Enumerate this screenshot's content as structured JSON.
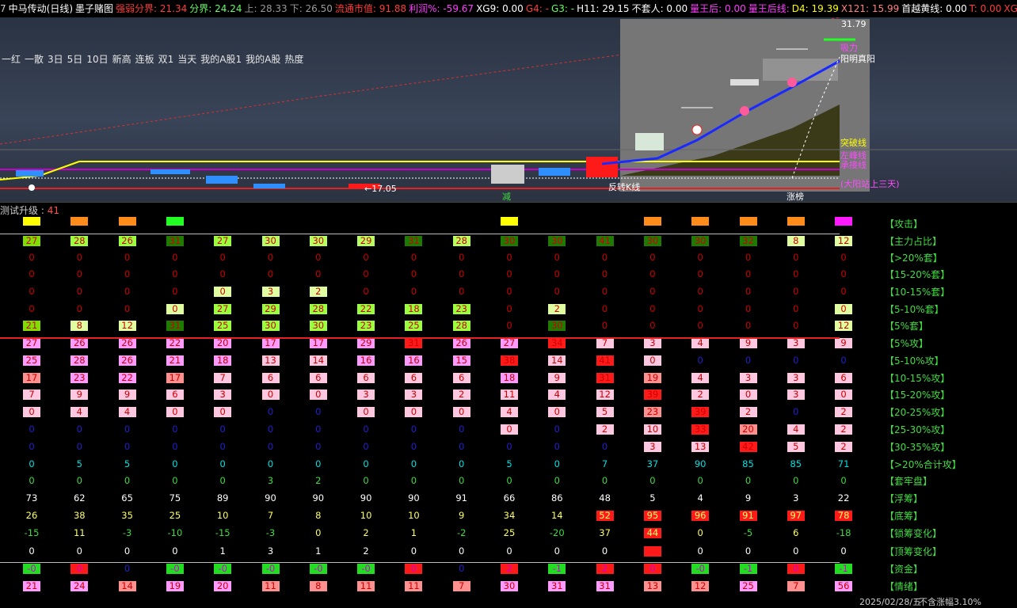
{
  "title_bar": {
    "items": [
      {
        "text": "7",
        "color": "#cccccc"
      },
      {
        "text": "中马传动(日线)",
        "color": "#ffffff"
      },
      {
        "text": "墨子赌图",
        "color": "#ffffff"
      },
      {
        "text": "强弱分界: 21.34",
        "color": "#ff3b3b"
      },
      {
        "text": "分界: 24.24",
        "color": "#5fff5f"
      },
      {
        "text": "上: 28.33",
        "color": "#9a9a9a"
      },
      {
        "text": "下: 26.50",
        "color": "#9a9a9a"
      },
      {
        "text": "流通市值: 91.88",
        "color": "#ff3b3b"
      },
      {
        "text": "利润%: -59.67",
        "color": "#ff3bff"
      },
      {
        "text": "XG9: 0.00",
        "color": "#ffffff"
      },
      {
        "text": "G4: -",
        "color": "#ff3b3b"
      },
      {
        "text": "G3: -",
        "color": "#5fff5f"
      },
      {
        "text": "H11: 29.15",
        "color": "#ffffff"
      },
      {
        "text": "不套人: 0.00",
        "color": "#ffffff"
      },
      {
        "text": "量王后: 0.00",
        "color": "#ff3bff"
      },
      {
        "text": "量王后线:",
        "color": "#ff3bff"
      },
      {
        "text": "D4: 19.39",
        "color": "#ffff00"
      },
      {
        "text": "X121: 15.99",
        "color": "#ff8080"
      },
      {
        "text": "首越黄线: 0.00",
        "color": "#ffffff"
      },
      {
        "text": "T: 0.00",
        "color": "#ff3b3b"
      },
      {
        "text": "XG",
        "color": "#ff3b3b"
      }
    ]
  },
  "quicklinks": [
    "一红",
    "一散",
    "3日",
    "5日",
    "10日",
    "新高",
    "连板",
    "双1",
    "当天",
    "我的A股1",
    "我的A股",
    "热度"
  ],
  "chart_annotations": {
    "price_top": "31.79",
    "low_label": "←17.05",
    "reversal": "反转K线",
    "limit_up": "涨榜",
    "reduce": "减",
    "labels_right": [
      "吸力",
      "阳明真阳",
      "突破线",
      "左峰线",
      "承接线",
      "(大阳站上三天)"
    ]
  },
  "subtitle": {
    "label": "测试升级",
    "value": "41"
  },
  "columns": 18,
  "attack_flags": [
    "#ffff00",
    "#ff8c1a",
    "#ff8c1a",
    "#22ff22",
    "",
    "",
    "",
    "",
    "",
    "",
    "#ffff00",
    "",
    "",
    "#ff8c1a",
    "#ff8c1a",
    "#ff8c1a",
    "#ff8c1a",
    "#ff1aff"
  ],
  "rows": [
    {
      "label": "【攻击】",
      "type": "flags"
    },
    {
      "label": "【主力占比】",
      "values": [
        "27",
        "28",
        "26",
        "31",
        "27",
        "30",
        "30",
        "29",
        "31",
        "28",
        "30",
        "30",
        "41",
        "30",
        "30",
        "32",
        "8",
        "12"
      ],
      "colors": [
        "#7fdd00",
        "#9aff3c",
        "#9aff3c",
        "#1f7a00",
        "#9aff3c",
        "#b8ff60",
        "#b8ff60",
        "#b8ff60",
        "#1f7a00",
        "#b8ff60",
        "#1f7a00",
        "#1f7a00",
        "#1f7a00",
        "#1f7a00",
        "#1f7a00",
        "#1f7a00",
        "#e0ffa0",
        "#e0ffa0"
      ],
      "text": [
        "#cc0000",
        "#cc0000",
        "#cc0000",
        "#cc0000",
        "#cc0000",
        "#cc0000",
        "#cc0000",
        "#cc0000",
        "#cc0000",
        "#cc0000",
        "#cc0000",
        "#cc0000",
        "#cc0000",
        "#cc0000",
        "#cc0000",
        "#cc0000",
        "#cc0000",
        "#cc0000"
      ]
    },
    {
      "label": "【>20%套】",
      "values": [
        "0",
        "0",
        "0",
        "0",
        "0",
        "0",
        "0",
        "0",
        "0",
        "0",
        "0",
        "0",
        "0",
        "0",
        "0",
        "0",
        "0",
        "0"
      ]
    },
    {
      "label": "【15-20%套】",
      "values": [
        "0",
        "0",
        "0",
        "0",
        "0",
        "0",
        "0",
        "0",
        "0",
        "0",
        "0",
        "0",
        "0",
        "0",
        "0",
        "0",
        "0",
        "0"
      ]
    },
    {
      "label": "【10-15%套】",
      "values": [
        "0",
        "0",
        "0",
        "0",
        "0",
        "3",
        "2",
        "0",
        "0",
        "0",
        "0",
        "0",
        "0",
        "0",
        "0",
        "0",
        "0",
        "0"
      ],
      "colors": [
        "",
        "",
        "",
        "",
        "#e0ffa0",
        "#e0ffa0",
        "#e0ffa0",
        "",
        "",
        "",
        "",
        "",
        "",
        "",
        "",
        "",
        "",
        ""
      ]
    },
    {
      "label": "【5-10%套】",
      "values": [
        "0",
        "0",
        "0",
        "0",
        "27",
        "29",
        "28",
        "22",
        "18",
        "23",
        "0",
        "2",
        "0",
        "0",
        "0",
        "0",
        "0",
        "0"
      ],
      "colors": [
        "",
        "",
        "",
        "#e0ffa0",
        "#9aff3c",
        "#9aff3c",
        "#9aff3c",
        "#9aff3c",
        "#9aff3c",
        "#9aff3c",
        "",
        "#e0ffa0",
        "",
        "",
        "",
        "",
        "",
        "#e0ffa0"
      ]
    },
    {
      "label": "【5%套】",
      "values": [
        "21",
        "8",
        "12",
        "31",
        "25",
        "30",
        "30",
        "23",
        "25",
        "28",
        "0",
        "30",
        "0",
        "0",
        "0",
        "0",
        "0",
        "12"
      ],
      "colors": [
        "#7fdd00",
        "#e0ffa0",
        "#e0ffa0",
        "#1f7a00",
        "#9aff3c",
        "#9aff3c",
        "#9aff3c",
        "#9aff3c",
        "#9aff3c",
        "#9aff3c",
        "",
        "#1f7a00",
        "",
        "",
        "",
        "",
        "",
        "#e0ffa0"
      ]
    },
    {
      "label": "【5%攻】",
      "values": [
        "27",
        "26",
        "26",
        "22",
        "20",
        "17",
        "17",
        "29",
        "31",
        "26",
        "27",
        "34",
        "7",
        "3",
        "4",
        "9",
        "3",
        "9"
      ],
      "colors": [
        "#ff9aff",
        "#ff9aff",
        "#ff9aff",
        "#ff9aff",
        "#ff9aff",
        "#ff9aff",
        "#ff9aff",
        "#ff9aff",
        "#ff1a1a",
        "#ff9aff",
        "#ff9aff",
        "#ff1a1a",
        "#ffc8e0",
        "#ffc8e0",
        "#ffc8e0",
        "#ffc8e0",
        "#ffc8e0",
        "#ffc8e0"
      ]
    },
    {
      "label": "【5-10%攻】",
      "values": [
        "25",
        "28",
        "26",
        "21",
        "18",
        "13",
        "14",
        "16",
        "16",
        "15",
        "38",
        "14",
        "41",
        "0",
        "0",
        "0",
        "0",
        "0"
      ],
      "colors": [
        "#ff9aff",
        "#ff9aff",
        "#ff9aff",
        "#ff9aff",
        "#ff9aff",
        "#ffc8e0",
        "#ffc8e0",
        "#ff9aff",
        "#ff9aff",
        "#ff9aff",
        "#ff1a1a",
        "#ffc8e0",
        "#ff1a1a",
        "#ffc8e0",
        "",
        "",
        "",
        ""
      ]
    },
    {
      "label": "【10-15%攻】",
      "values": [
        "17",
        "23",
        "22",
        "17",
        "7",
        "6",
        "6",
        "6",
        "6",
        "6",
        "18",
        "9",
        "31",
        "19",
        "4",
        "3",
        "3",
        "6"
      ],
      "colors": [
        "#ff9090",
        "#ff9aff",
        "#ff9aff",
        "#ff9090",
        "#ffc8e0",
        "#ffc8e0",
        "#ffc8e0",
        "#ffc8e0",
        "#ffc8e0",
        "#ffc8e0",
        "#ff9aff",
        "#ffc8e0",
        "#ff1a1a",
        "#ff9090",
        "#ffc8e0",
        "#ffc8e0",
        "#ffc8e0",
        "#ffc8e0"
      ]
    },
    {
      "label": "【15-20%攻】",
      "values": [
        "7",
        "9",
        "9",
        "6",
        "3",
        "0",
        "0",
        "3",
        "3",
        "2",
        "11",
        "4",
        "12",
        "39",
        "2",
        "0",
        "3",
        "0"
      ],
      "colors": [
        "#ffc8e0",
        "#ffc8e0",
        "#ffc8e0",
        "#ffc8e0",
        "#ffc8e0",
        "#ffc8e0",
        "#ffc8e0",
        "#ffc8e0",
        "#ffc8e0",
        "#ffc8e0",
        "#ffc8e0",
        "#ffc8e0",
        "#ffc8e0",
        "#ff1a1a",
        "#ffc8e0",
        "#ffc8e0",
        "#ffc8e0",
        "#ffc8e0"
      ]
    },
    {
      "label": "【20-25%攻】",
      "values": [
        "0",
        "4",
        "4",
        "0",
        "0",
        "0",
        "0",
        "0",
        "0",
        "0",
        "4",
        "0",
        "5",
        "23",
        "39",
        "2",
        "0",
        "2"
      ],
      "colors": [
        "#ffc8e0",
        "#ffc8e0",
        "#ffc8e0",
        "#ffc8e0",
        "#ffc8e0",
        "",
        "",
        "#ffc8e0",
        "#ffc8e0",
        "#ffc8e0",
        "#ffc8e0",
        "#ffc8e0",
        "#ffc8e0",
        "#ff9090",
        "#ff1a1a",
        "#ffc8e0",
        "",
        "#ffc8e0"
      ]
    },
    {
      "label": "【25-30%攻】",
      "values": [
        "0",
        "0",
        "0",
        "0",
        "0",
        "0",
        "0",
        "0",
        "0",
        "0",
        "0",
        "0",
        "2",
        "10",
        "33",
        "20",
        "4",
        "2"
      ],
      "colors": [
        "",
        "",
        "",
        "",
        "",
        "",
        "",
        "",
        "",
        "",
        "#ffc8e0",
        "",
        "#ffc8e0",
        "#ffc8e0",
        "#ff1a1a",
        "#ff9090",
        "#ffc8e0",
        "#ffc8e0"
      ]
    },
    {
      "label": "【30-35%攻】",
      "values": [
        "0",
        "0",
        "0",
        "0",
        "0",
        "0",
        "0",
        "0",
        "0",
        "0",
        "0",
        "0",
        "0",
        "3",
        "13",
        "42",
        "5",
        "2"
      ],
      "colors": [
        "",
        "",
        "",
        "",
        "",
        "",
        "",
        "",
        "",
        "",
        "",
        "",
        "",
        "#ffc8e0",
        "#ffc8e0",
        "#ff1a1a",
        "#ffc8e0",
        "#ffc8e0"
      ]
    },
    {
      "label": "【>20%合计攻】",
      "values": [
        "0",
        "5",
        "5",
        "0",
        "0",
        "0",
        "0",
        "0",
        "0",
        "0",
        "5",
        "0",
        "7",
        "37",
        "90",
        "85",
        "85",
        "71"
      ],
      "text": [
        "#00e0e0",
        "#00e0e0",
        "#00e0e0",
        "#00e0e0",
        "#00e0e0",
        "#00e0e0",
        "#00e0e0",
        "#00e0e0",
        "#00e0e0",
        "#00e0e0",
        "#00e0e0",
        "#00e0e0",
        "#00e0e0",
        "#00e0e0",
        "#00e0e0",
        "#00e0e0",
        "#00e0e0",
        "#00e0e0"
      ]
    },
    {
      "label": "【套牢盘】",
      "values": [
        "0",
        "0",
        "0",
        "0",
        "0",
        "3",
        "2",
        "0",
        "0",
        "0",
        "0",
        "0",
        "0",
        "0",
        "0",
        "0",
        "0",
        "0"
      ],
      "text": [
        "#3fdc3f",
        "#3fdc3f",
        "#3fdc3f",
        "#3fdc3f",
        "#3fdc3f",
        "#3fdc3f",
        "#3fdc3f",
        "#3fdc3f",
        "#3fdc3f",
        "#3fdc3f",
        "#3fdc3f",
        "#3fdc3f",
        "#3fdc3f",
        "#3fdc3f",
        "#3fdc3f",
        "#3fdc3f",
        "#3fdc3f",
        "#3fdc3f"
      ]
    },
    {
      "label": "【浮筹】",
      "values": [
        "73",
        "62",
        "65",
        "75",
        "89",
        "90",
        "90",
        "90",
        "90",
        "91",
        "66",
        "86",
        "48",
        "5",
        "4",
        "9",
        "3",
        "22"
      ],
      "text": [
        "#ffffff",
        "#ffffff",
        "#ffffff",
        "#ffffff",
        "#ffffff",
        "#ffffff",
        "#ffffff",
        "#ffffff",
        "#ffffff",
        "#ffffff",
        "#ffffff",
        "#ffffff",
        "#ffffff",
        "#ffffff",
        "#ffffff",
        "#ffffff",
        "#ffffff",
        "#ffffff"
      ]
    },
    {
      "label": "【底筹】",
      "values": [
        "26",
        "38",
        "35",
        "25",
        "10",
        "7",
        "8",
        "10",
        "10",
        "9",
        "34",
        "14",
        "52",
        "95",
        "96",
        "91",
        "97",
        "78"
      ],
      "colors": [
        "",
        "",
        "",
        "",
        "",
        "",
        "",
        "",
        "",
        "",
        "",
        "",
        "#ff1a1a",
        "#ff1a1a",
        "#ff1a1a",
        "#ff1a1a",
        "#ff1a1a",
        "#ff1a1a"
      ],
      "text": [
        "#ffff66",
        "#ffff66",
        "#ffff66",
        "#ffff66",
        "#ffff66",
        "#ffff66",
        "#ffff66",
        "#ffff66",
        "#ffff66",
        "#ffff66",
        "#ffff66",
        "#ffff66",
        "#ffff66",
        "#ffff66",
        "#ffff66",
        "#ffff66",
        "#ffff66",
        "#ffff66"
      ]
    },
    {
      "label": "【锁筹变化】",
      "values": [
        "-15",
        "11",
        "-3",
        "-10",
        "-15",
        "-3",
        "0",
        "2",
        "1",
        "-2",
        "25",
        "-20",
        "37",
        "44",
        "0",
        "-5",
        "6",
        "-18"
      ],
      "colors": [
        "",
        "",
        "",
        "",
        "",
        "",
        "",
        "",
        "",
        "",
        "",
        "",
        "",
        "#ff1a1a",
        "",
        "",
        "",
        ""
      ],
      "text": [
        "#3fdc3f",
        "#ffff66",
        "#3fdc3f",
        "#3fdc3f",
        "#3fdc3f",
        "#3fdc3f",
        "#ffff66",
        "#ffff66",
        "#ffff66",
        "#3fdc3f",
        "#ffff66",
        "#3fdc3f",
        "#ffff66",
        "#ffff66",
        "#ffff66",
        "#3fdc3f",
        "#ffff66",
        "#3fdc3f"
      ]
    },
    {
      "label": "【顶筹变化】",
      "values": [
        "0",
        "0",
        "0",
        "0",
        "1",
        "3",
        "1",
        "2",
        "0",
        "0",
        "0",
        "0",
        "0",
        "",
        "0",
        "0",
        "0",
        "0"
      ],
      "colors": [
        "",
        "",
        "",
        "",
        "",
        "",
        "",
        "",
        "",
        "",
        "",
        "",
        "",
        "#ff1a1a",
        "",
        "",
        "",
        ""
      ],
      "text": [
        "#ffffff",
        "#ffffff",
        "#ffffff",
        "#ffffff",
        "#ffffff",
        "#ffffff",
        "#ffffff",
        "#ffffff",
        "#ffffff",
        "#ffffff",
        "#ffffff",
        "#ffffff",
        "#ffffff",
        "#ffffff",
        "#ffffff",
        "#ffffff",
        "#ffffff",
        "#ffffff"
      ]
    },
    {
      "label": "【资金】",
      "values": [
        "-0",
        "0",
        "0",
        "-0",
        "-0",
        "-0",
        "-0",
        "-0",
        "0",
        "0",
        "2",
        "-1",
        "2",
        "0",
        "-0",
        "-1",
        "0",
        "-1"
      ],
      "colors": [
        "#22dd22",
        "#ff1a1a",
        "",
        "#22dd22",
        "#22dd22",
        "#22dd22",
        "#22dd22",
        "#22dd22",
        "#ff1a1a",
        "",
        "#ff1a1a",
        "#22dd22",
        "#ff1a1a",
        "#ff1a1a",
        "#22dd22",
        "#22dd22",
        "#ff1a1a",
        "#22dd22"
      ],
      "text": [
        "#cc00cc",
        "#cc00cc",
        "#2020cc",
        "#cc00cc",
        "#cc00cc",
        "#cc00cc",
        "#cc00cc",
        "#cc00cc",
        "#cc00cc",
        "#2020cc",
        "#cc00cc",
        "#cc00cc",
        "#cc00cc",
        "#cc00cc",
        "#cc00cc",
        "#cc00cc",
        "#cc00cc",
        "#cc00cc"
      ]
    },
    {
      "label": "【情绪】",
      "values": [
        "21",
        "24",
        "14",
        "19",
        "20",
        "11",
        "8",
        "11",
        "11",
        "7",
        "30",
        "31",
        "31",
        "13",
        "12",
        "25",
        "7",
        "56"
      ],
      "colors": [
        "#ff9aff",
        "#ff9aff",
        "#ff9090",
        "#ff9aff",
        "#ff9aff",
        "#ff9090",
        "#ff9090",
        "#ff9090",
        "#ff9090",
        "#ff9090",
        "#ff9aff",
        "#ff9aff",
        "#ff9aff",
        "#ff9090",
        "#ff9090",
        "#ff9aff",
        "#ff9090",
        "#ff9aff"
      ]
    }
  ],
  "footer": {
    "date": "2025/02/28/五",
    "note": "不含涨幅3.10%"
  }
}
